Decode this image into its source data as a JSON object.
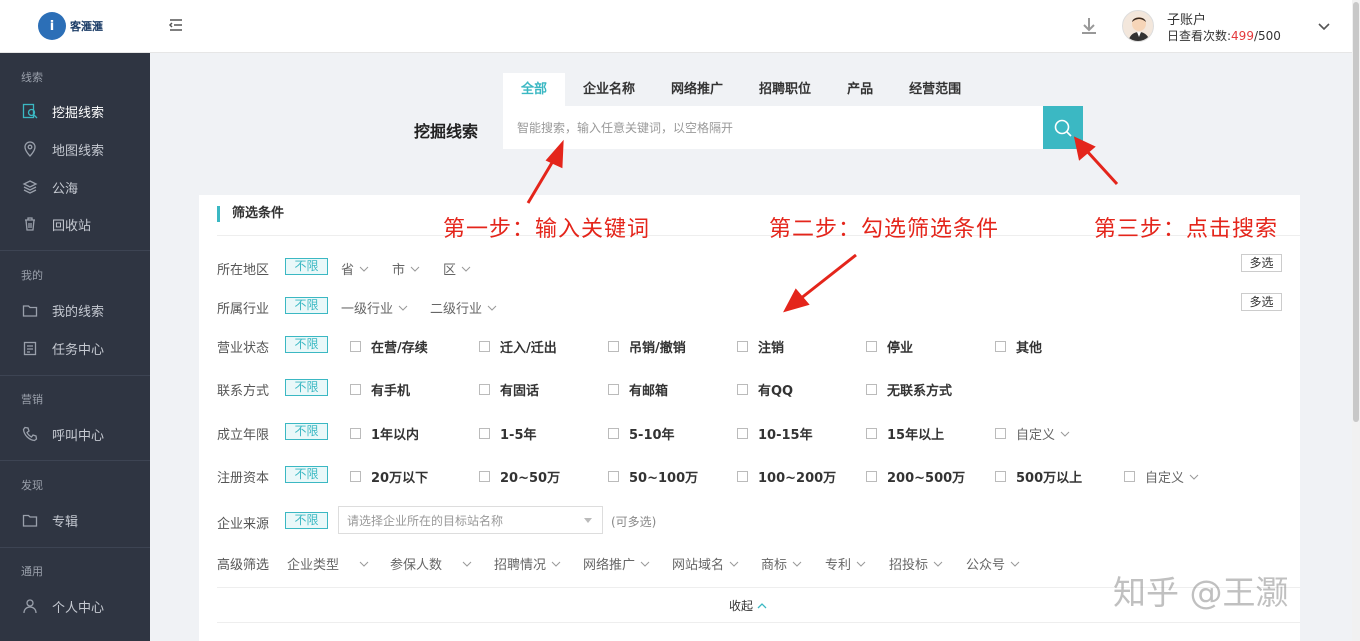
{
  "header": {
    "logo_text": "客滙滙",
    "user_name": "子账户",
    "quota_label": "日查看次数:",
    "quota_used": "499",
    "quota_total": "/500"
  },
  "sidebar": {
    "groups": [
      {
        "title": "线索",
        "items": [
          {
            "label": "挖掘线索",
            "icon": "search-doc-icon",
            "active": true
          },
          {
            "label": "地图线索",
            "icon": "map-pin-icon"
          },
          {
            "label": "公海",
            "icon": "layers-icon"
          },
          {
            "label": "回收站",
            "icon": "trash-icon"
          }
        ]
      },
      {
        "title": "我的",
        "items": [
          {
            "label": "我的线索",
            "icon": "folder-icon"
          },
          {
            "label": "任务中心",
            "icon": "clipboard-icon"
          }
        ]
      },
      {
        "title": "营销",
        "items": [
          {
            "label": "呼叫中心",
            "icon": "phone-icon"
          }
        ]
      },
      {
        "title": "发现",
        "items": [
          {
            "label": "专辑",
            "icon": "album-folder-icon"
          }
        ]
      },
      {
        "title": "通用",
        "items": [
          {
            "label": "个人中心",
            "icon": "user-icon"
          }
        ]
      }
    ]
  },
  "search": {
    "tabs": [
      "全部",
      "企业名称",
      "网络推广",
      "招聘职位",
      "产品",
      "经营范围"
    ],
    "active_tab": "全部",
    "label": "挖掘线索",
    "placeholder": "智能搜索，输入任意关键词，以空格隔开"
  },
  "filters": {
    "title": "筛选条件",
    "unlimited": "不限",
    "multi_select": "多选",
    "region": {
      "label": "所在地区",
      "dropdowns": [
        "省",
        "市",
        "区"
      ]
    },
    "industry": {
      "label": "所属行业",
      "dropdowns": [
        "一级行业",
        "二级行业"
      ]
    },
    "status": {
      "label": "营业状态",
      "options": [
        "在营/存续",
        "迁入/迁出",
        "吊销/撤销",
        "注销",
        "停业",
        "其他"
      ]
    },
    "contact": {
      "label": "联系方式",
      "options": [
        "有手机",
        "有固话",
        "有邮箱",
        "有QQ",
        "无联系方式"
      ]
    },
    "founded": {
      "label": "成立年限",
      "options": [
        "1年以内",
        "1-5年",
        "5-10年",
        "10-15年",
        "15年以上"
      ],
      "custom": "自定义"
    },
    "capital": {
      "label": "注册资本",
      "options": [
        "20万以下",
        "20~50万",
        "50~100万",
        "100~200万",
        "200~500万",
        "500万以上"
      ],
      "custom": "自定义"
    },
    "source": {
      "label": "企业来源",
      "placeholder": "请选择企业所在的目标站名称",
      "note": "(可多选)"
    },
    "advanced": {
      "label": "高级筛选",
      "dropdowns": [
        "企业类型",
        "参保人数",
        "招聘情况",
        "网络推广",
        "网站域名",
        "商标",
        "专利",
        "招投标",
        "公众号"
      ]
    },
    "collapse": "收起"
  },
  "annotations": {
    "step1": "第一步：输入关键词",
    "step2": "第二步：勾选筛选条件",
    "step3": "第三步：点击搜索",
    "color": "#e4251b"
  },
  "watermark": "知乎 @王灏",
  "colors": {
    "accent": "#3bb8c3",
    "sidebar_bg": "#2f3542",
    "quota_used": "#e4393c"
  }
}
